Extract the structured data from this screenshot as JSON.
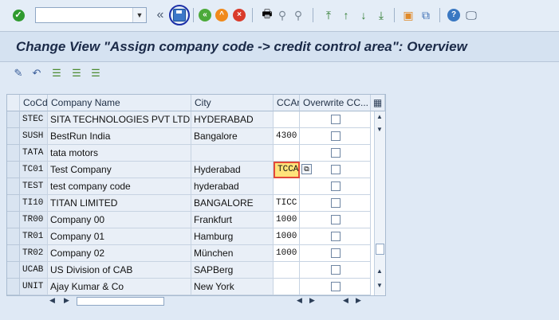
{
  "toolbar": {
    "command_value": "",
    "icons": [
      "enter-icon",
      "command-dropdown-icon",
      "collapse-icon",
      "save-icon",
      "back-icon",
      "exit-icon",
      "cancel-icon",
      "print-icon",
      "find-icon",
      "find-next-icon",
      "first-page-icon",
      "previous-page-icon",
      "next-page-icon",
      "last-page-icon",
      "new-session-icon",
      "shortcut-icon",
      "help-icon",
      "layout-icon"
    ]
  },
  "title": "Change View \"Assign company code -> credit control area\": Overview",
  "app_toolbar": {
    "icons": [
      "display-change-icon",
      "undo-icon",
      "select-all-icon",
      "select-block-icon",
      "deselect-all-icon"
    ]
  },
  "table": {
    "columns": [
      "CoCd",
      "Company Name",
      "City",
      "CCAr",
      "Overwrite CC..."
    ],
    "rows": [
      {
        "cocd": "STEC",
        "name": "SITA TECHNOLOGIES PVT LTD",
        "city": "HYDERABAD",
        "ccar": "",
        "overwrite": false
      },
      {
        "cocd": "SUSH",
        "name": "BestRun India",
        "city": "Bangalore",
        "ccar": "4300",
        "overwrite": false
      },
      {
        "cocd": "TATA",
        "name": "tata motors",
        "city": "",
        "ccar": "",
        "overwrite": false
      },
      {
        "cocd": "TC01",
        "name": "Test Company",
        "city": "Hyderabad",
        "ccar": "TCCA",
        "overwrite": false
      },
      {
        "cocd": "TEST",
        "name": "test company code",
        "city": "hyderabad",
        "ccar": "",
        "overwrite": false
      },
      {
        "cocd": "TI10",
        "name": "TITAN LIMITED",
        "city": "BANGALORE",
        "ccar": "TICC",
        "overwrite": false
      },
      {
        "cocd": "TR00",
        "name": "Company 00",
        "city": "Frankfurt",
        "ccar": "1000",
        "overwrite": false
      },
      {
        "cocd": "TR01",
        "name": "Company 01",
        "city": "Hamburg",
        "ccar": "1000",
        "overwrite": false
      },
      {
        "cocd": "TR02",
        "name": "Company 02",
        "city": "München",
        "ccar": "1000",
        "overwrite": false
      },
      {
        "cocd": "UCAB",
        "name": "US Division of CAB",
        "city": "SAPBerg",
        "ccar": "",
        "overwrite": false
      },
      {
        "cocd": "UNIT",
        "name": "Ajay Kumar & Co",
        "city": "New York",
        "ccar": "",
        "overwrite": false
      }
    ],
    "active_row": 3,
    "colors": {
      "highlight": "#ffe37a",
      "focus_border": "#e24a3a",
      "save_marker": "#1a2ea8"
    }
  }
}
